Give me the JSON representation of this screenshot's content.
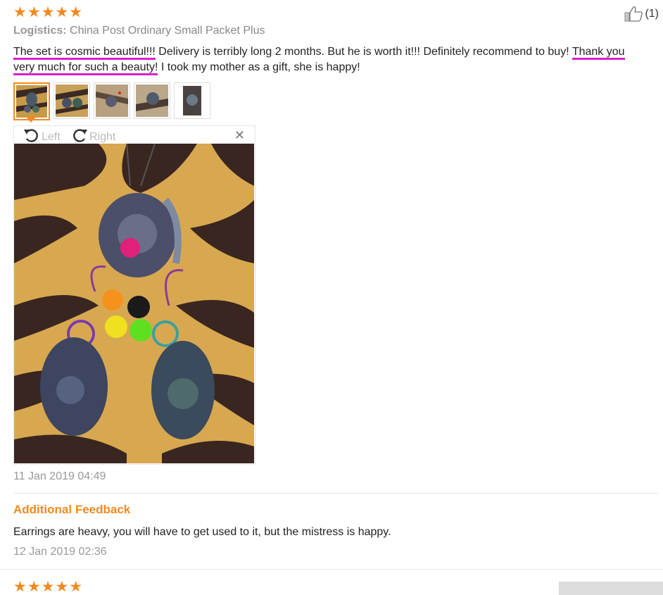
{
  "review": {
    "stars": "★★★★★",
    "like_count": "(1)",
    "logistics_label": "Logistics:",
    "logistics_value": "China Post Ordinary Small Packet Plus",
    "text_part1": "The set is cosmic beautiful!!!",
    "text_part2": " Delivery is terribly long 2 months. But he is worth it!!! Definitely recommend to buy! ",
    "text_part3": "Thank you",
    "text_part4": "very much for such a beauty!",
    "text_part5": " I took my mother as a gift, she is happy!",
    "highlight_color": "#d91fcf",
    "thumbnails": [
      "thumb-1",
      "thumb-2",
      "thumb-3",
      "thumb-4",
      "thumb-5"
    ],
    "viewer": {
      "rotate_left_label": "Left",
      "rotate_right_label": "Right",
      "close_symbol": "✕"
    },
    "date": "11 Jan 2019 04:49",
    "additional_feedback": {
      "title": "Additional Feedback",
      "text": "Earrings are heavy, you will have to get used to it, but the mistress is happy.",
      "date": "12 Jan 2019 02:36"
    }
  },
  "next_review": {
    "stars": "★★★★★"
  },
  "colors": {
    "accent": "#f5891f",
    "muted_text": "#999999",
    "body_text": "#222222"
  },
  "icons": [
    "star-icon",
    "thumbs-up-icon",
    "rotate-left-icon",
    "rotate-right-icon",
    "close-icon"
  ]
}
